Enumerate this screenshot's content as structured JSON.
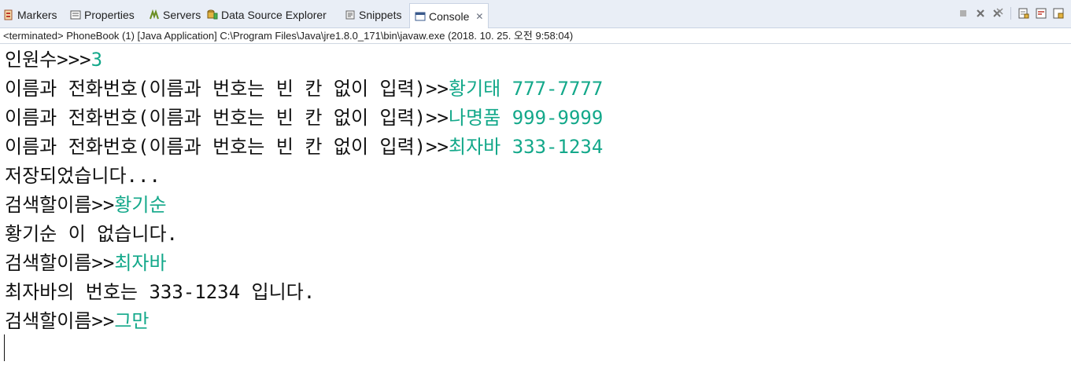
{
  "tabs": [
    {
      "label": "Markers",
      "icon": "markers-icon"
    },
    {
      "label": "Properties",
      "icon": "properties-icon"
    },
    {
      "label": "Servers",
      "icon": "servers-icon"
    },
    {
      "label": "Data Source Explorer",
      "icon": "data-source-icon"
    },
    {
      "label": "Snippets",
      "icon": "snippets-icon"
    },
    {
      "label": "Console",
      "icon": "console-icon",
      "active": true
    }
  ],
  "status": "<terminated> PhoneBook (1) [Java Application] C:\\Program Files\\Java\\jre1.8.0_171\\bin\\javaw.exe (2018. 10. 25. 오전 9:58:04)",
  "console": {
    "lines": [
      {
        "out": "인원수>>>",
        "in": "3"
      },
      {
        "out": "이름과 전화번호(이름과 번호는 빈 칸 없이 입력)>>",
        "in": "황기태 777-7777"
      },
      {
        "out": "이름과 전화번호(이름과 번호는 빈 칸 없이 입력)>>",
        "in": "나명품 999-9999"
      },
      {
        "out": "이름과 전화번호(이름과 번호는 빈 칸 없이 입력)>>",
        "in": "최자바 333-1234"
      },
      {
        "out": "저장되었습니다...",
        "in": ""
      },
      {
        "out": "검색할이름>>",
        "in": "황기순"
      },
      {
        "out": "황기순 이 없습니다.",
        "in": ""
      },
      {
        "out": "검색할이름>>",
        "in": "최자바"
      },
      {
        "out": "최자바의 번호는 333-1234 입니다.",
        "in": ""
      },
      {
        "out": "검색할이름>>",
        "in": "그만"
      }
    ]
  },
  "colors": {
    "input_text": "#13a88a",
    "tabbar_bg": "#e9eef6"
  }
}
